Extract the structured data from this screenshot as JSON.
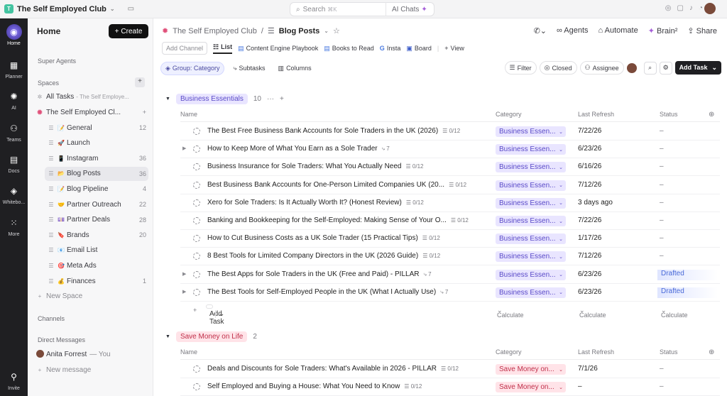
{
  "topbar": {
    "workspace": "The Self Employed Club",
    "ws_initial": "T",
    "search_placeholder": "Search",
    "search_kbd": "⌘K",
    "ai_chats": "AI Chats"
  },
  "rail": {
    "items": [
      {
        "label": "Home",
        "icon": "home-icon"
      },
      {
        "label": "Planner",
        "icon": "calendar-icon"
      },
      {
        "label": "AI",
        "icon": "ai-icon"
      },
      {
        "label": "Teams",
        "icon": "teams-icon"
      },
      {
        "label": "Docs",
        "icon": "docs-icon"
      },
      {
        "label": "Whitebo...",
        "icon": "whiteboard-icon"
      },
      {
        "label": "More",
        "icon": "grid-icon"
      },
      {
        "label": "Invite",
        "icon": "add-user-icon"
      }
    ]
  },
  "sidebar": {
    "title": "Home",
    "create": "Create",
    "super_agents": "Super Agents",
    "spaces": "Spaces",
    "all_tasks": "All Tasks",
    "all_tasks_sub": "- The Self Employe...",
    "space_name": "The Self Employed Cl...",
    "items": [
      {
        "label": "General",
        "count": "12",
        "emoji": "📝"
      },
      {
        "label": "Launch",
        "count": "",
        "emoji": "🚀"
      },
      {
        "label": "Instagram",
        "count": "36",
        "emoji": "📱"
      },
      {
        "label": "Blog Posts",
        "count": "36",
        "emoji": "📂"
      },
      {
        "label": "Blog Pipeline",
        "count": "4",
        "emoji": "📝"
      },
      {
        "label": "Partner Outreach",
        "count": "22",
        "emoji": "🤝"
      },
      {
        "label": "Partner Deals",
        "count": "28",
        "emoji": "💷"
      },
      {
        "label": "Brands",
        "count": "20",
        "emoji": "🔖"
      },
      {
        "label": "Email List",
        "count": "",
        "emoji": "📧"
      },
      {
        "label": "Meta Ads",
        "count": "",
        "emoji": "🎯"
      },
      {
        "label": "Finances",
        "count": "1",
        "emoji": "💰"
      }
    ],
    "new_space": "New Space",
    "channels": "Channels",
    "direct_messages": "Direct Messages",
    "dm_user": "Anita Forrest",
    "dm_you": "— You",
    "new_message": "New message"
  },
  "main": {
    "breadcrumb_space": "The Self Employed Club",
    "breadcrumb_sep": "/",
    "breadcrumb_list": "Blog Posts",
    "header_actions": [
      "Agents",
      "Automate",
      "Brain²",
      "Share"
    ],
    "views": {
      "add_channel": "Add Channel",
      "list": "List",
      "tabs": [
        "Content Engine Playbook",
        "Books to Read",
        "Insta",
        "Board"
      ],
      "add_view": "View"
    },
    "toolbar": {
      "group": "Group: Category",
      "subtasks": "Subtasks",
      "columns": "Columns",
      "filter": "Filter",
      "closed": "Closed",
      "assignee": "Assignee",
      "add_task": "Add Task"
    },
    "columns": {
      "name": "Name",
      "category": "Category",
      "last_refresh": "Last Refresh",
      "status": "Status"
    },
    "groups": [
      {
        "label": "Business Essentials",
        "count": "10",
        "tasks": [
          {
            "name": "The Best Free Business Bank Accounts for Sole Traders in the UK (2026)",
            "sub": "☰ 0/12",
            "cat": "Business Essen...",
            "refresh": "7/22/26",
            "status": "–"
          },
          {
            "name": "How to Keep More of What You Earn as a Sole Trader",
            "sub": "⤷ 7",
            "cat": "Business Essen...",
            "refresh": "6/23/26",
            "status": "–",
            "expand": true
          },
          {
            "name": "Business Insurance for Sole Traders: What You Actually Need",
            "sub": "☰ 0/12",
            "cat": "Business Essen...",
            "refresh": "6/16/26",
            "status": "–"
          },
          {
            "name": "Best Business Bank Accounts for One-Person Limited Companies UK (20...",
            "sub": "☰ 0/12",
            "cat": "Business Essen...",
            "refresh": "7/12/26",
            "status": "–"
          },
          {
            "name": "Xero for Sole Traders: Is It Actually Worth It? (Honest Review)",
            "sub": "☰ 0/12",
            "cat": "Business Essen...",
            "refresh": "3 days ago",
            "status": "–"
          },
          {
            "name": "Banking and Bookkeeping for the Self-Employed: Making Sense of Your O...",
            "sub": "☰ 0/12",
            "cat": "Business Essen...",
            "refresh": "7/22/26",
            "status": "–"
          },
          {
            "name": "How to Cut Business Costs as a UK Sole Trader (15 Practical Tips)",
            "sub": "☰ 0/12",
            "cat": "Business Essen...",
            "refresh": "1/17/26",
            "status": "–"
          },
          {
            "name": "8 Best Tools for Limited Company Directors in the UK (2026 Guide)",
            "sub": "☰ 0/12",
            "cat": "Business Essen...",
            "refresh": "7/12/26",
            "status": "–"
          },
          {
            "name": "The Best Apps for Sole Traders in the UK (Free and Paid) - PILLAR",
            "sub": "⤷ 7",
            "cat": "Business Essen...",
            "refresh": "6/23/26",
            "status": "Drafted",
            "expand": true
          },
          {
            "name": "The Best Tools for Self-Employed People in the UK (What I Actually Use)",
            "sub": "⤷ 7",
            "cat": "Business Essen...",
            "refresh": "6/23/26",
            "status": "Drafted",
            "expand": true
          }
        ],
        "add_task": "Add Task",
        "calculate": "Calculate"
      },
      {
        "label": "Save Money on Life",
        "count": "2",
        "tasks": [
          {
            "name": "Deals and Discounts for Sole Traders: What's Available in 2026 - PILLAR",
            "sub": "☰ 0/12",
            "cat": "Save Money on...",
            "refresh": "7/1/26",
            "status": "–"
          },
          {
            "name": "Self Employed and Buying a House: What You Need to Know",
            "sub": "☰ 0/12",
            "cat": "Save Money on...",
            "refresh": "–",
            "status": "–"
          }
        ]
      }
    ]
  },
  "colors": {
    "group1_bg": "#e9e5ff",
    "group1_fg": "#5a4ac8",
    "group2_bg": "#ffe3e8",
    "group2_fg": "#c0304a"
  }
}
